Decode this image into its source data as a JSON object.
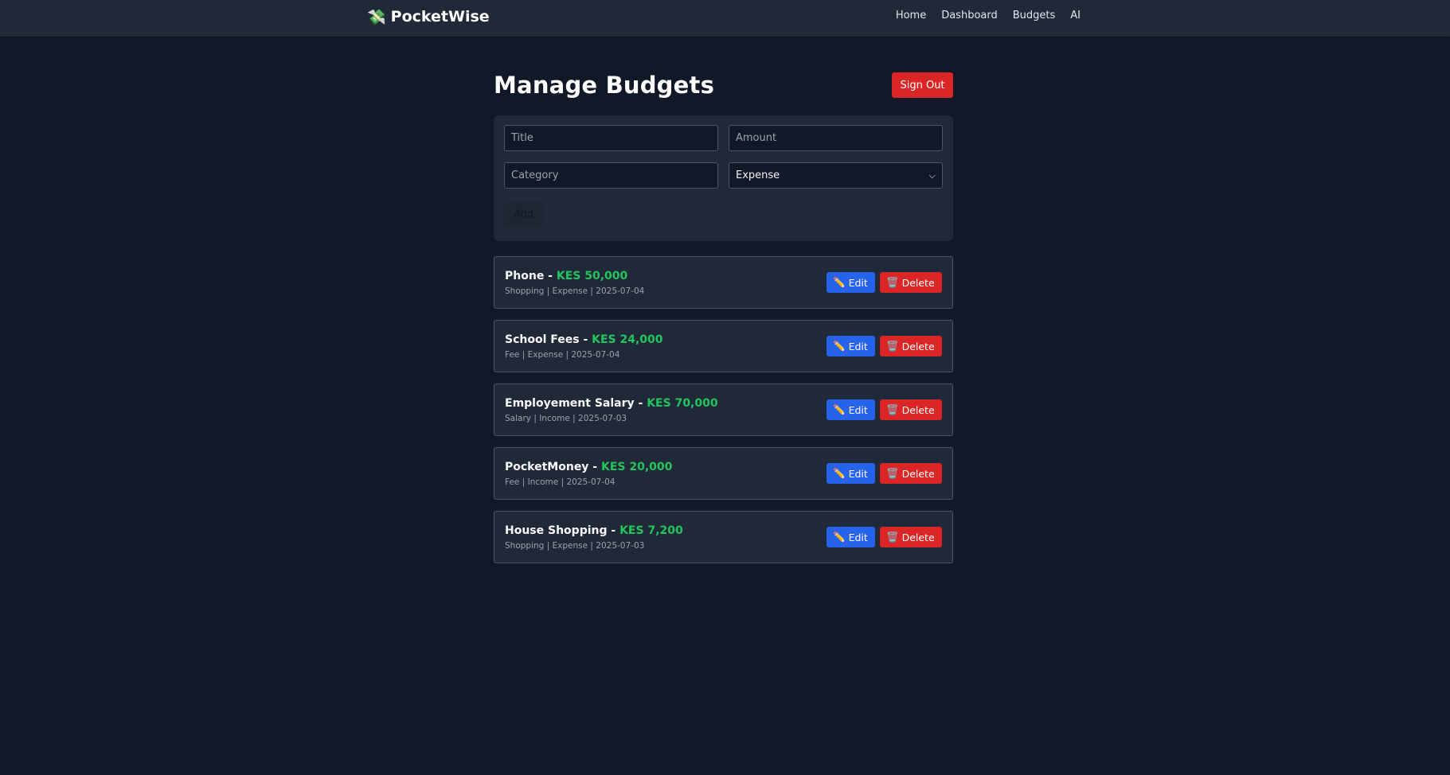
{
  "brand": {
    "icon": "💸",
    "icon_name": "money-wings-icon",
    "name": "PocketWise"
  },
  "nav": {
    "items": [
      "Home",
      "Dashboard",
      "Budgets",
      "AI"
    ]
  },
  "page": {
    "title": "Manage Budgets",
    "signout_label": "Sign Out"
  },
  "form": {
    "title_placeholder": "Title",
    "amount_placeholder": "Amount",
    "category_placeholder": "Category",
    "type_value": "Expense",
    "type_options": [
      "Expense"
    ],
    "add_label": "Add"
  },
  "buttons": {
    "edit_label": "Edit",
    "edit_icon": "✏️",
    "delete_label": "Delete",
    "delete_icon": "🗑️"
  },
  "budgets": [
    {
      "title": "Phone",
      "amount": "KES 50,000",
      "meta": "Shopping | Expense | 2025-07-04"
    },
    {
      "title": "School Fees",
      "amount": "KES 24,000",
      "meta": "Fee | Expense | 2025-07-04"
    },
    {
      "title": "Employement Salary",
      "amount": "KES 70,000",
      "meta": "Salary | Income | 2025-07-03"
    },
    {
      "title": "PocketMoney",
      "amount": "KES 20,000",
      "meta": "Fee | Income | 2025-07-04"
    },
    {
      "title": "House Shopping",
      "amount": "KES 7,200",
      "meta": "Shopping | Expense | 2025-07-03"
    }
  ],
  "colors": {
    "background": "#111827",
    "card": "#1f2937",
    "accent_green": "#22c55e",
    "edit_blue": "#2563eb",
    "danger_red": "#dc2626"
  }
}
